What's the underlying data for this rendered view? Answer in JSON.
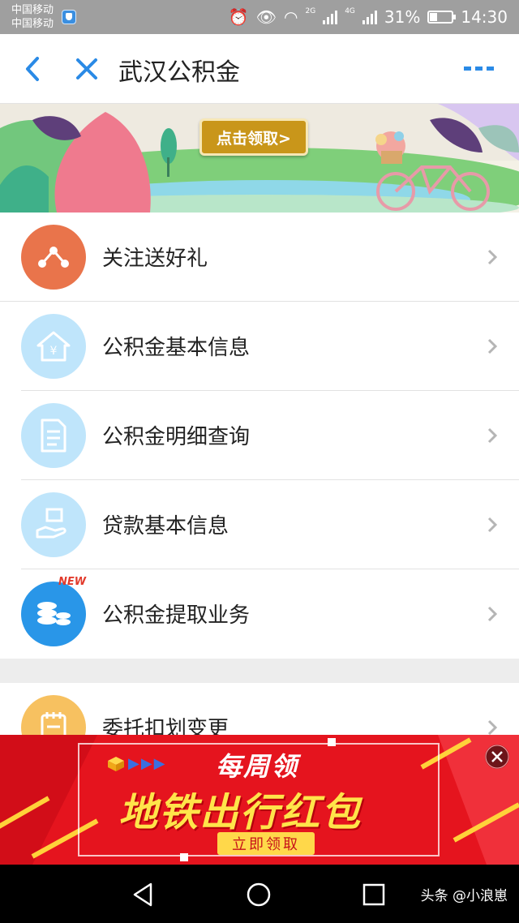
{
  "status_bar": {
    "carrier_1": "中国移动",
    "carrier_2": "中国移动",
    "net_a": "2G",
    "net_b": "4G",
    "battery": "31%",
    "time": "14:30"
  },
  "nav": {
    "title": "武汉公积金"
  },
  "banner": {
    "button_label": "点击领取>"
  },
  "menu": {
    "items": [
      {
        "label": "关注送好礼",
        "icon": "share-nodes-icon",
        "color": "#e9744b"
      },
      {
        "label": "公积金基本信息",
        "icon": "house-yuan-icon",
        "color": "#bfe5fb"
      },
      {
        "label": "公积金明细查询",
        "icon": "document-icon",
        "color": "#bfe5fb"
      },
      {
        "label": "贷款基本信息",
        "icon": "hand-money-icon",
        "color": "#bfe5fb"
      },
      {
        "label": "公积金提取业务",
        "icon": "coins-icon",
        "color": "#2996e8",
        "badge": "NEW"
      }
    ]
  },
  "menu2": {
    "items": [
      {
        "label": "委托扣划变更",
        "icon": "notepad-icon",
        "color": "#f7c160"
      }
    ]
  },
  "ad": {
    "line1": "每周领",
    "line2": "地铁出行红包",
    "button": "立即领取"
  },
  "watermark": "头条 @小浪崽"
}
